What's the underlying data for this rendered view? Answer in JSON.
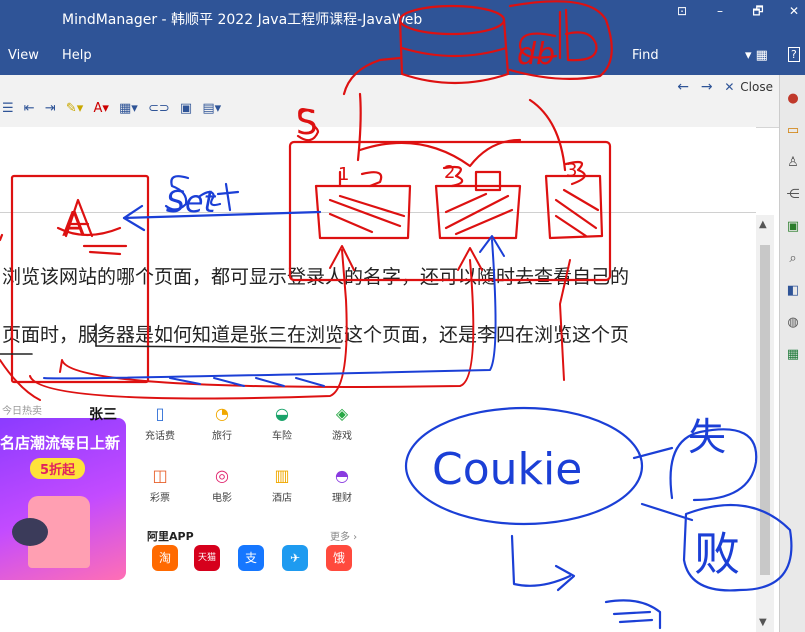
{
  "window": {
    "title": "MindManager - 韩顺平 2022 Java工程师课程-JavaWeb",
    "controls": [
      "⊡",
      "–",
      "🗗",
      "✕"
    ]
  },
  "menu": {
    "view": "View",
    "help": "Help",
    "find": "Find"
  },
  "ribbon": {
    "close": "Close",
    "icons": [
      "bullet-list",
      "outdent",
      "indent",
      "highlight",
      "font-color",
      "table",
      "link",
      "image",
      "attachment"
    ]
  },
  "document": {
    "line1": "浏览该网站的哪个页面，都可显示登录人的名字，还可以随时去查看自己的",
    "line2": "页面时，服务器是如何知道是张三在浏览这个页面，还是李四在浏览这个页",
    "hot_label": "今日热卖",
    "banner_line1": "名店潮流每日上新",
    "banner_badge": "5折起",
    "user_name": "张三",
    "services": [
      "充话费",
      "旅行",
      "车险",
      "游戏",
      "彩票",
      "电影",
      "酒店",
      "理财"
    ],
    "ali_app_label": "阿里APP",
    "more_label": "更多 ›",
    "apps": [
      "淘",
      "天猫",
      "支",
      "✈",
      "饿"
    ]
  },
  "annotations": {
    "db": "db",
    "set": "Set",
    "a_label": "A",
    "s_label": "S",
    "n1": "1",
    "n2": "2",
    "n3": "3",
    "cookie": "Coukie",
    "session_char1": "失",
    "session_char2": "败"
  }
}
